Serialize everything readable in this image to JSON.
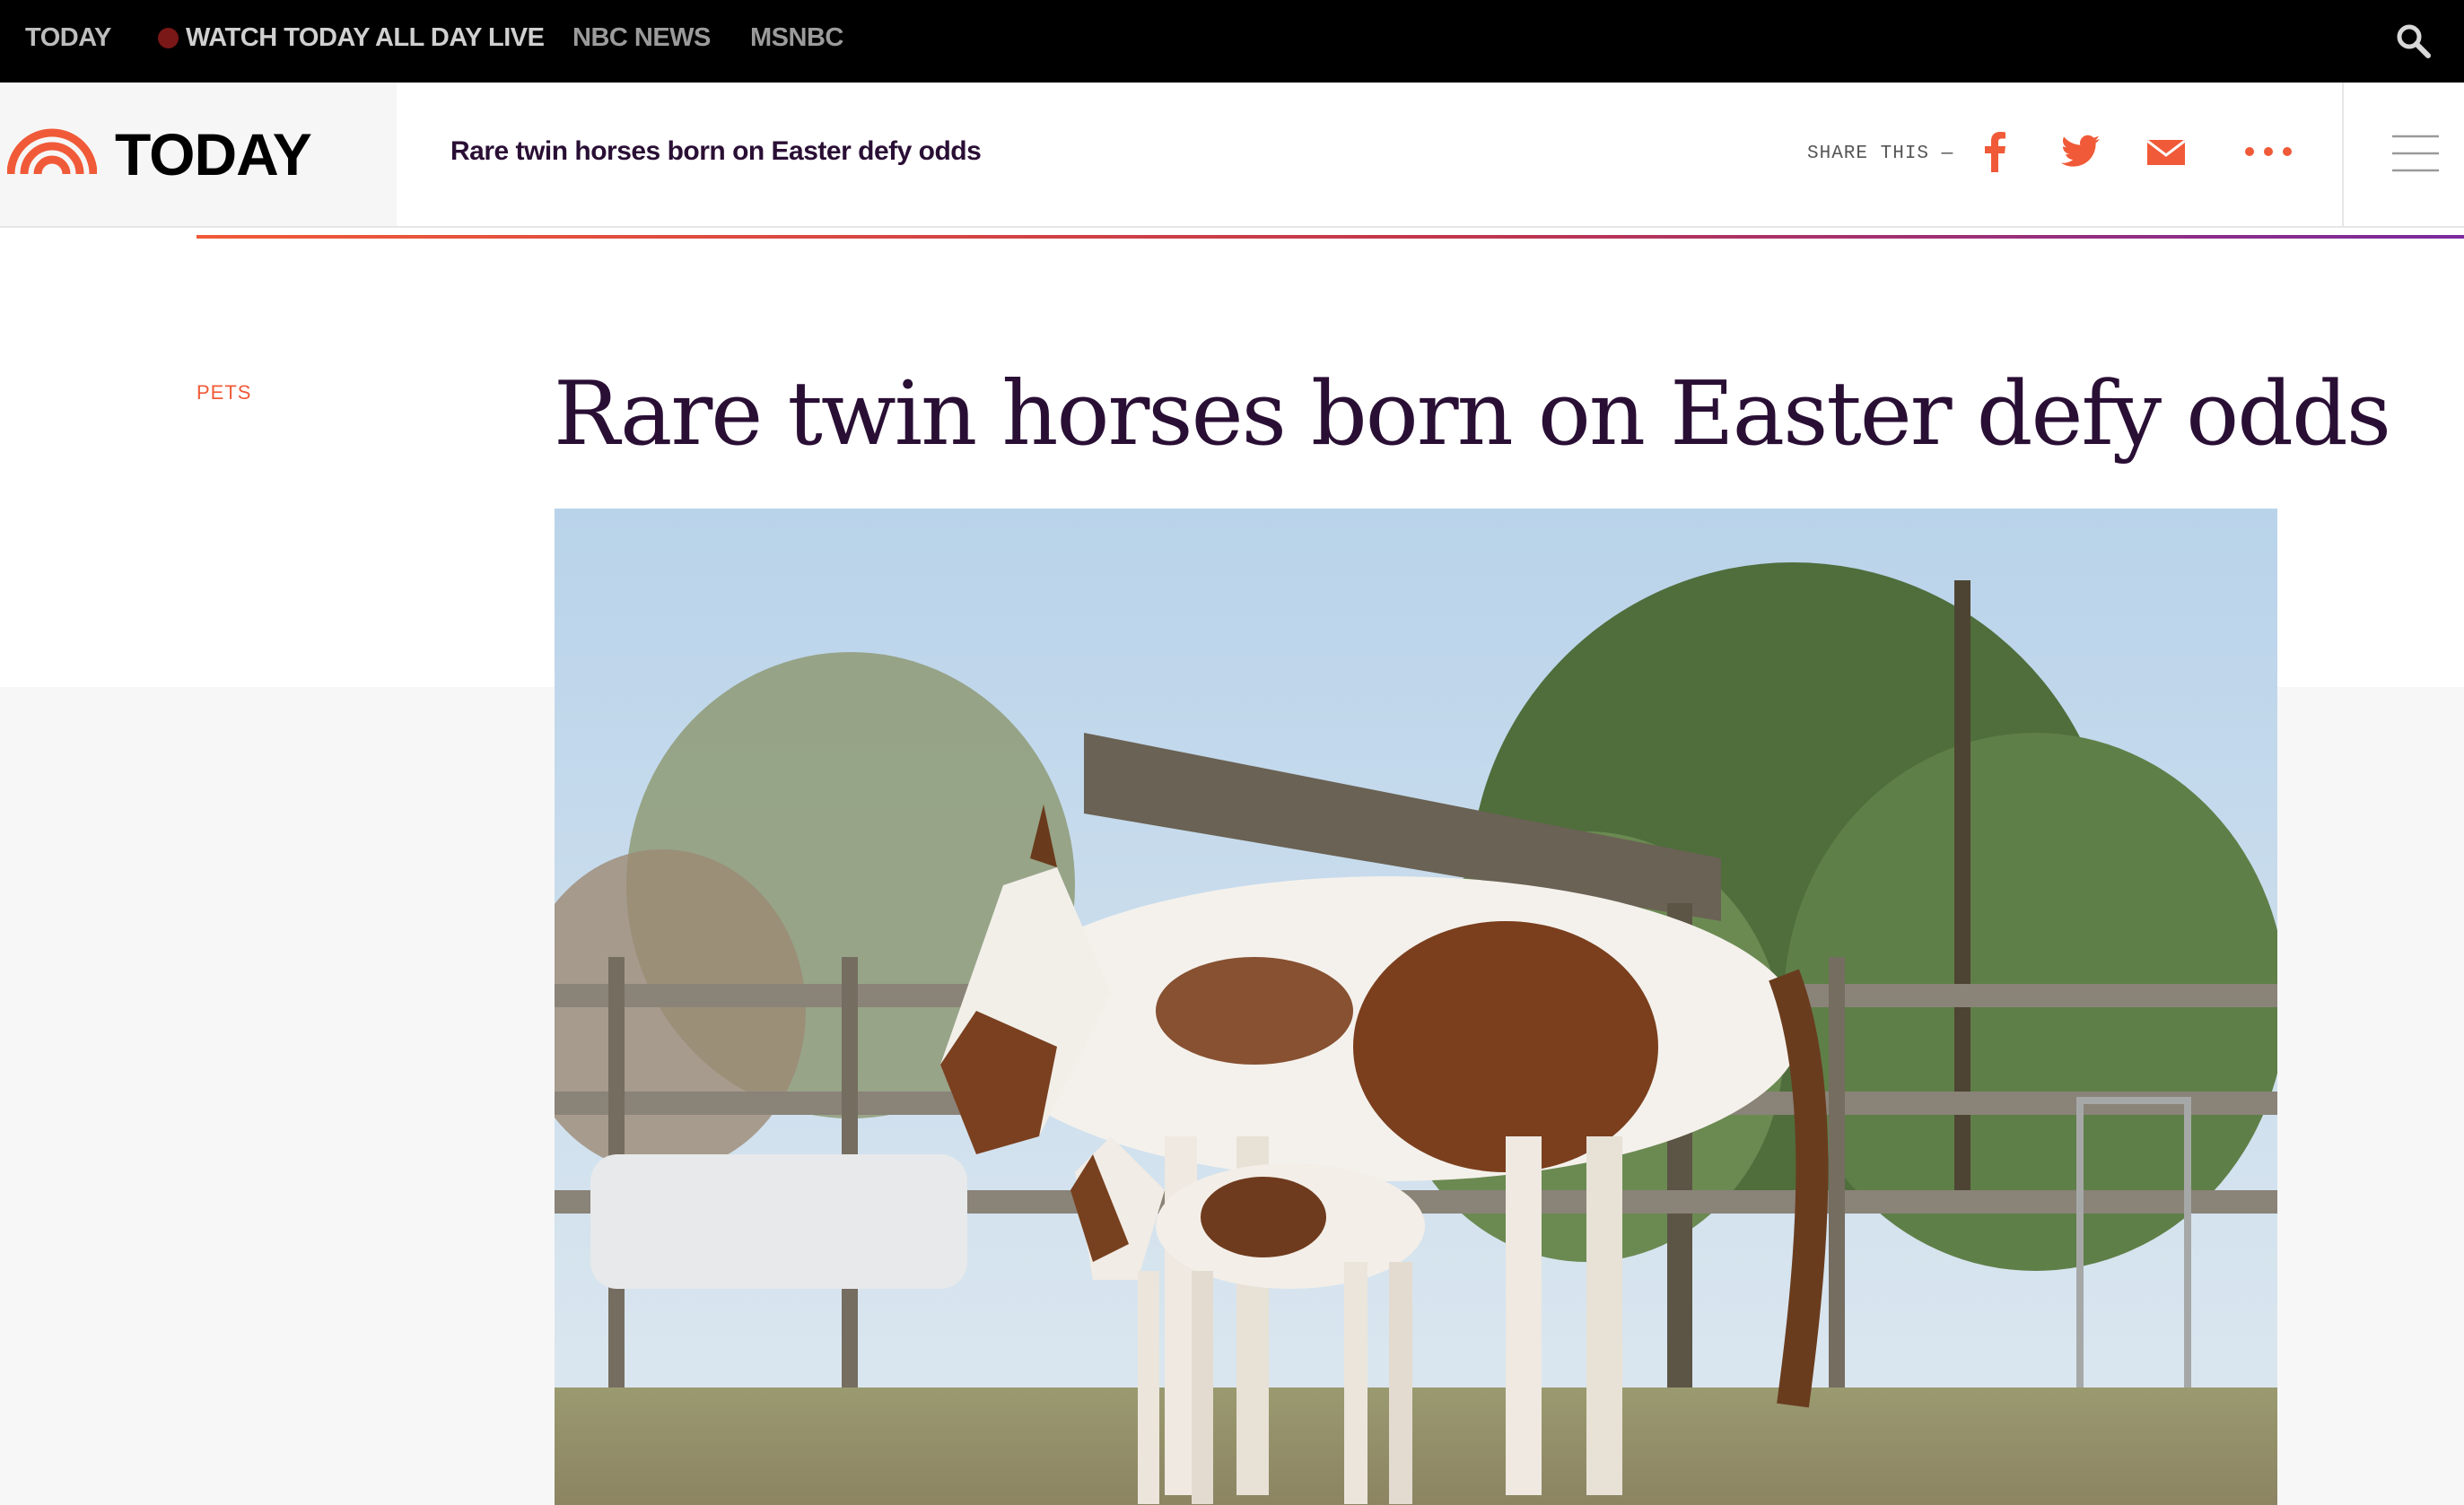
{
  "topbar": {
    "today": "TODAY",
    "watch_live": "WATCH TODAY ALL DAY LIVE",
    "nbc_news": "NBC NEWS",
    "msnbc": "MSNBC"
  },
  "header": {
    "logo_text": "TODAY",
    "article_title": "Rare twin horses born on Easter defy odds",
    "share_label": "SHARE THIS —"
  },
  "article": {
    "category": "PETS",
    "headline": "Rare twin horses born on Easter defy odds"
  },
  "colors": {
    "accent": "#f05a38",
    "headline": "#2a0f35",
    "gradient_end": "#7a2a9e"
  },
  "icons": [
    "search-icon",
    "today-sunrise-logo",
    "facebook-icon",
    "twitter-icon",
    "email-icon",
    "more-icon",
    "hamburger-menu-icon"
  ]
}
